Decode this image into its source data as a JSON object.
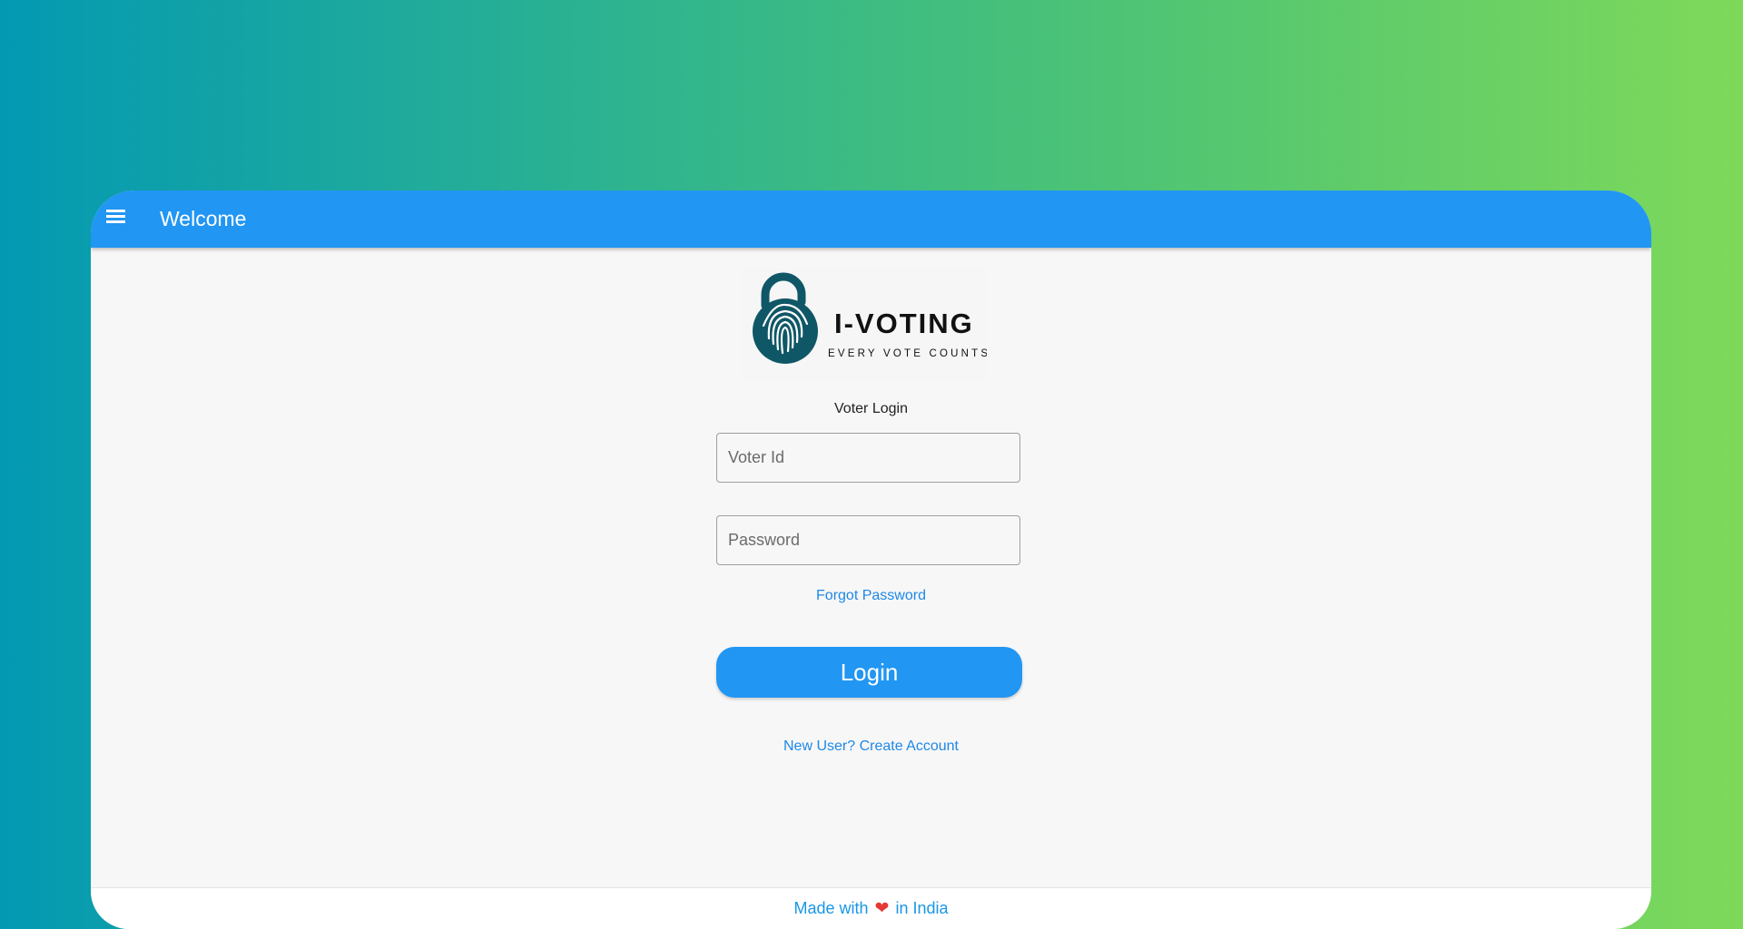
{
  "header": {
    "title": "Welcome",
    "menu_icon": "hamburger-menu-icon"
  },
  "logo": {
    "brand": "I-VOTING",
    "tagline": "EVERY VOTE COUNTS",
    "icon": "padlock-fingerprint-icon",
    "color": "#0f5766"
  },
  "login": {
    "section_label": "Voter Login",
    "voter_id_placeholder": "Voter Id",
    "password_placeholder": "Password",
    "forgot_password": "Forgot Password",
    "login_label": "Login",
    "create_account": "New User? Create Account"
  },
  "footer": {
    "prefix": "Made with",
    "heart": "❤",
    "suffix": "in India"
  },
  "colors": {
    "app_bar": "#2196f3",
    "link": "#1e88e5",
    "background_gradient": [
      "#0399b3",
      "#7ed95a"
    ]
  }
}
